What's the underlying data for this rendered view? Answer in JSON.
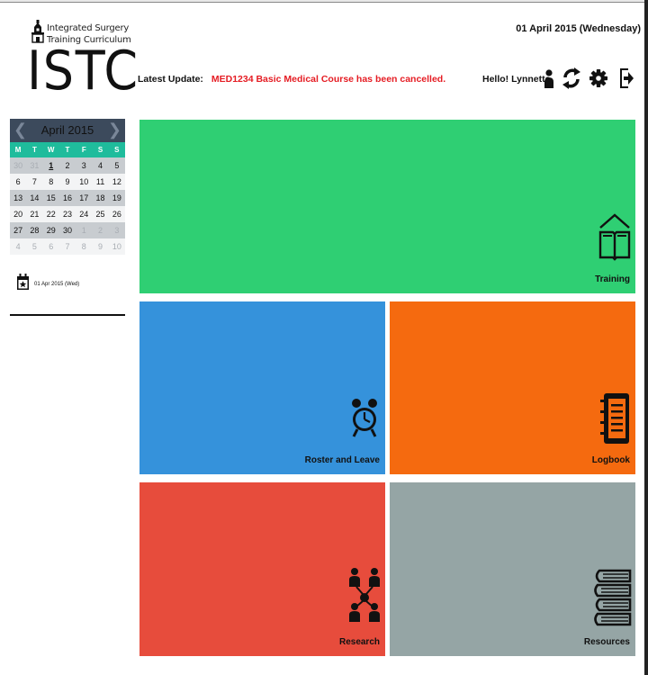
{
  "logo": {
    "line1": "Integrated Surgery",
    "line2": "Training Curriculum",
    "acronym": "ISTC"
  },
  "header": {
    "date": "01 April 2015 (Wednesday)",
    "latest_label": "Latest Update:",
    "latest_message": "MED1234 Basic Medical Course has been cancelled.",
    "greeting": "Hello! Lynnette",
    "icons": [
      "user-icon",
      "refresh-icon",
      "gear-icon",
      "logout-icon"
    ]
  },
  "calendar": {
    "prev": "❮",
    "next": "❯",
    "month": "April",
    "year": "2015",
    "weekdays": [
      "M",
      "T",
      "W",
      "T",
      "F",
      "S",
      "S"
    ],
    "weeks": [
      [
        "30",
        "31",
        "1",
        "2",
        "3",
        "4",
        "5"
      ],
      [
        "6",
        "7",
        "8",
        "9",
        "10",
        "11",
        "12"
      ],
      [
        "13",
        "14",
        "15",
        "16",
        "17",
        "18",
        "19"
      ],
      [
        "20",
        "21",
        "22",
        "23",
        "24",
        "25",
        "26"
      ],
      [
        "27",
        "28",
        "29",
        "30",
        "1",
        "2",
        "3"
      ],
      [
        "4",
        "5",
        "6",
        "7",
        "8",
        "9",
        "10"
      ]
    ],
    "selected_date": "01 Apr 2015 (Wed)"
  },
  "tiles": {
    "training": "Training",
    "roster": "Roster and Leave",
    "logbook": "Logbook",
    "research": "Research",
    "resources": "Resources"
  },
  "colors": {
    "training": "#2fcf73",
    "roster": "#3592db",
    "logbook": "#f56a0f",
    "research": "#e74c3c",
    "resources": "#95a5a5",
    "alert": "#e51c23",
    "calendar_header": "#3c4a5c",
    "calendar_weekdays": "#1fbc9c"
  }
}
